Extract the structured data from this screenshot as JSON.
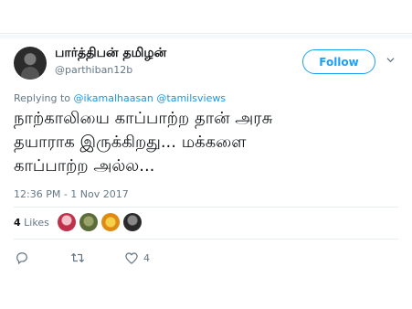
{
  "tweet": {
    "display_name": "பார்த்திபன் தமிழன்",
    "handle": "@parthiban12b",
    "follow_label": "Follow",
    "replying_prefix": "Replying to",
    "reply_mentions": [
      "@ikamalhaasan",
      "@tamilsviews"
    ],
    "text": "நாற்காலியை காப்பாற்ற தான் அரசு\nதயாராக  இருக்கிறது... மக்களை\nகாப்பாற்ற அல்ல...",
    "timestamp": "12:36 PM - 1 Nov 2017",
    "likes_count": "4",
    "likes_label": "Likes",
    "liker_avatars": [
      "liker-avatar-1",
      "liker-avatar-2",
      "liker-avatar-3",
      "liker-avatar-4"
    ],
    "actions": {
      "reply_icon": "reply-icon",
      "retweet_icon": "retweet-icon",
      "like_icon": "heart-icon",
      "like_count": "4"
    }
  },
  "colors": {
    "accent": "#1da1f2",
    "mention": "#1b95e0",
    "secondary_text": "#657786",
    "divider": "#e6ecf0"
  }
}
